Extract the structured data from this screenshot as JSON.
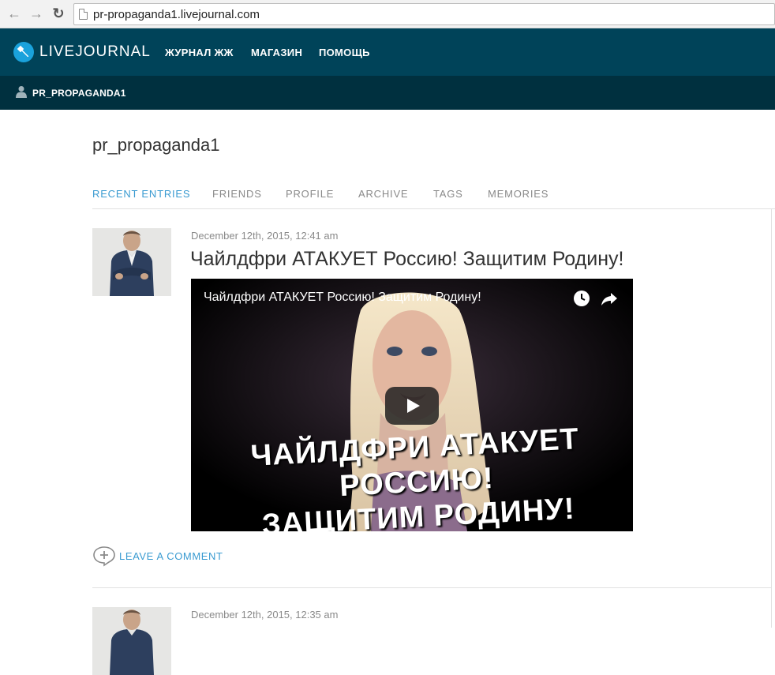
{
  "browser": {
    "url": "pr-propaganda1.livejournal.com"
  },
  "header": {
    "logo_text": "LIVEJOURNAL",
    "nav": [
      "ЖУРНАЛ ЖЖ",
      "МАГАЗИН",
      "ПОМОЩЬ"
    ],
    "username": "PR_PROPAGANDA1"
  },
  "journal": {
    "title": "pr_propaganda1",
    "tabs": [
      "RECENT ENTRIES",
      "FRIENDS",
      "PROFILE",
      "ARCHIVE",
      "TAGS",
      "MEMORIES"
    ],
    "active_tab": "RECENT ENTRIES"
  },
  "entries": [
    {
      "date": "December 12th, 2015, 12:41 am",
      "title": "Чайлдфри АТАКУЕТ Россию! Защитим Родину!",
      "video": {
        "title": "Чайлдфри АТАКУЕТ Россию! Защитим Родину!",
        "caption_line1": "ЧАЙЛДФРИ АТАКУЕТ РОССИЮ!",
        "caption_line2": "ЗАЩИТИМ РОДИНУ!"
      },
      "comment_label": "LEAVE A COMMENT"
    },
    {
      "date": "December 12th, 2015, 12:35 am"
    }
  ],
  "colors": {
    "header_bg": "#004359",
    "userbar_bg": "#00303f",
    "accent": "#3a9bd1",
    "logo_blue": "#1aa2dc"
  }
}
